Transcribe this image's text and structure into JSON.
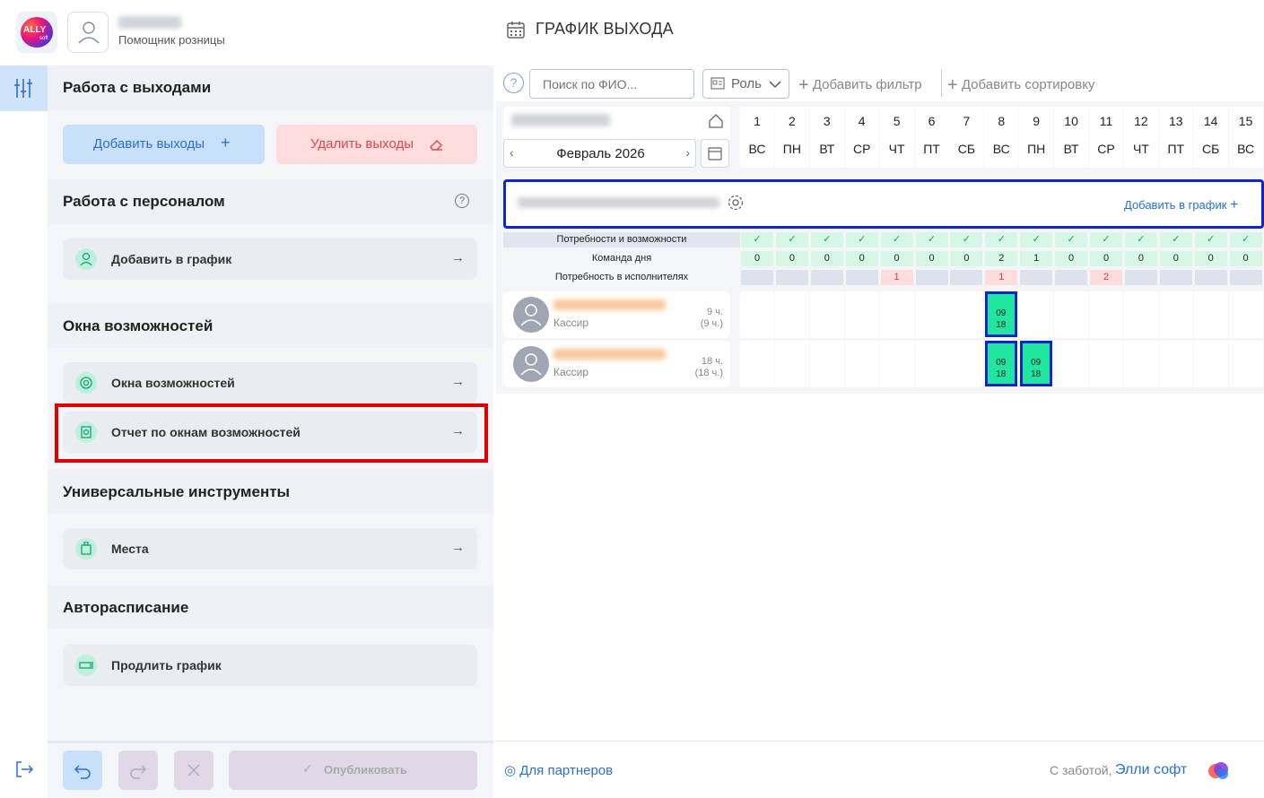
{
  "header": {
    "logo_text": "ALLY",
    "logo_sub": "soft",
    "user_role": "Помощник розницы",
    "page_title": "ГРАФИК ВЫХОДА"
  },
  "panel": {
    "work_shifts_title": "Работа с выходами",
    "add_shifts_label": "Добавить выходы",
    "delete_shifts_label": "Удалить выходы",
    "staff_title": "Работа с персоналом",
    "add_to_schedule_label": "Добавить в график",
    "opportunity_title": "Окна возможностей",
    "opportunity_item_label": "Окна возможностей",
    "opportunity_report_label": "Отчет по окнам возможностей",
    "universal_title": "Универсальные инструменты",
    "places_label": "Места",
    "autoschedule_title": "Авторасписание",
    "extend_schedule_label": "Продлить график",
    "publish_label": "Опубликовать"
  },
  "toolbar": {
    "help": "?",
    "search_placeholder": "Поиск по ФИО...",
    "role_label": "Роль",
    "add_filter_label": "Добавить фильтр",
    "add_sort_label": "Добавить сортировку"
  },
  "calendar": {
    "month_label": "Февраль 2026",
    "days": [
      {
        "num": "1",
        "dow": "ВС"
      },
      {
        "num": "2",
        "dow": "ПН"
      },
      {
        "num": "3",
        "dow": "ВТ"
      },
      {
        "num": "4",
        "dow": "СР"
      },
      {
        "num": "5",
        "dow": "ЧТ"
      },
      {
        "num": "6",
        "dow": "ПТ"
      },
      {
        "num": "7",
        "dow": "СБ"
      },
      {
        "num": "8",
        "dow": "ВС"
      },
      {
        "num": "9",
        "dow": "ПН"
      },
      {
        "num": "10",
        "dow": "ВТ"
      },
      {
        "num": "11",
        "dow": "СР"
      },
      {
        "num": "12",
        "dow": "ЧТ"
      },
      {
        "num": "13",
        "dow": "ПТ"
      },
      {
        "num": "14",
        "dow": "СБ"
      },
      {
        "num": "15",
        "dow": "ВС"
      }
    ]
  },
  "team": {
    "add_to_schedule_label": "Добавить в график"
  },
  "summary_rows": {
    "needs_label": "Потребности и возможности",
    "team_label": "Команда дня",
    "executors_label": "Потребность в исполнителях",
    "needs_mark": "✓",
    "team_values": [
      "0",
      "0",
      "0",
      "0",
      "0",
      "0",
      "0",
      "2",
      "1",
      "0",
      "0",
      "0",
      "0",
      "0",
      "0"
    ],
    "executor_values": [
      "",
      "",
      "",
      "",
      "1",
      "",
      "",
      "1",
      "",
      "",
      "2",
      "",
      "",
      "",
      ""
    ]
  },
  "employees": [
    {
      "role": "Кассир",
      "hours": "9 ч.",
      "hours_planned": "(9 ч.)",
      "shifts": [
        {
          "day": 8,
          "start": "09",
          "end": "18"
        }
      ]
    },
    {
      "role": "Кассир",
      "hours": "18 ч.",
      "hours_planned": "(18 ч.)",
      "shifts": [
        {
          "day": 8,
          "start": "09",
          "end": "18"
        },
        {
          "day": 9,
          "start": "09",
          "end": "18"
        }
      ]
    }
  ],
  "footer": {
    "partners_label": "Для партнеров",
    "made_by_label": "С заботой,",
    "brand_label": "Элли софт"
  },
  "colors": {
    "accent": "#2a6fd6",
    "highlight": "#e00000",
    "selection": "#1024c8",
    "shift_fill": "#20e6a0",
    "ok_green": "#d6f7e6",
    "need_red": "#fddcdc"
  }
}
